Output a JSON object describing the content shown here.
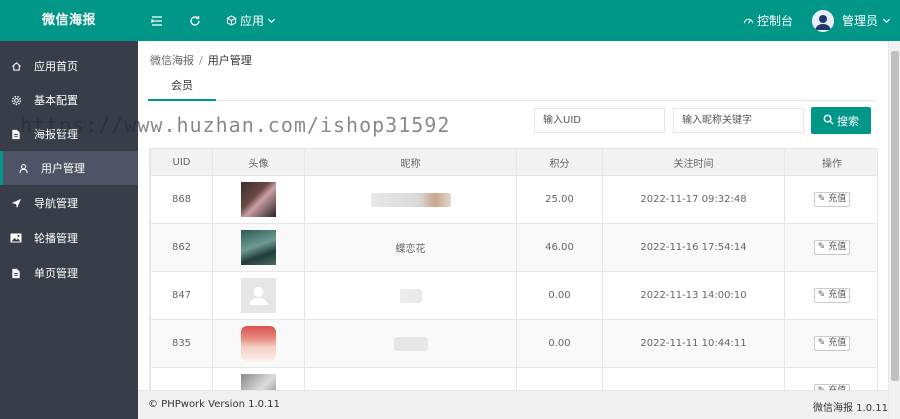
{
  "brand": "微信海报",
  "topbar": {
    "menu_icon": "menu-icon",
    "refresh_icon": "refresh-icon",
    "apps_label": "应用",
    "control_label": "控制台",
    "admin_label": "管理员"
  },
  "sidebar": {
    "items": [
      {
        "label": "应用首页",
        "icon": "home-icon"
      },
      {
        "label": "基本配置",
        "icon": "gear-icon"
      },
      {
        "label": "海报管理",
        "icon": "file-icon"
      },
      {
        "label": "用户管理",
        "icon": "user-icon"
      },
      {
        "label": "导航管理",
        "icon": "navigation-icon"
      },
      {
        "label": "轮播管理",
        "icon": "image-icon"
      },
      {
        "label": "单页管理",
        "icon": "page-icon"
      }
    ]
  },
  "breadcrumb": {
    "root": "微信海报",
    "sep": "/",
    "current": "用户管理"
  },
  "tabs": [
    {
      "label": "会员"
    }
  ],
  "search": {
    "uid_placeholder": "输入UID",
    "nick_placeholder": "输入昵称关键字",
    "button_label": "搜索"
  },
  "table": {
    "headers": [
      "UID",
      "头像",
      "昵称",
      "积分",
      "关注时间",
      "操作"
    ],
    "rows": [
      {
        "uid": "868",
        "nickname": "",
        "points": "25.00",
        "time": "2022-11-17 09:32:48",
        "action": "充值"
      },
      {
        "uid": "862",
        "nickname": "蝶恋花",
        "points": "46.00",
        "time": "2022-11-16 17:54:14",
        "action": "充值"
      },
      {
        "uid": "847",
        "nickname": "",
        "points": "0.00",
        "time": "2022-11-13 14:00:10",
        "action": "充值"
      },
      {
        "uid": "835",
        "nickname": "",
        "points": "0.00",
        "time": "2022-11-11 10:44:11",
        "action": "充值"
      },
      {
        "uid": "",
        "nickname": "",
        "points": "",
        "time": "",
        "action": "充值"
      }
    ]
  },
  "footer": {
    "left": "© PHPwork Version 1.0.11",
    "right": "微信海报 1.0.11"
  },
  "watermark": "https://www.huzhan.com/ishop31592",
  "colors": {
    "accent": "#009688",
    "sidebar": "#393d49",
    "sidebar_active": "#4e5465"
  }
}
